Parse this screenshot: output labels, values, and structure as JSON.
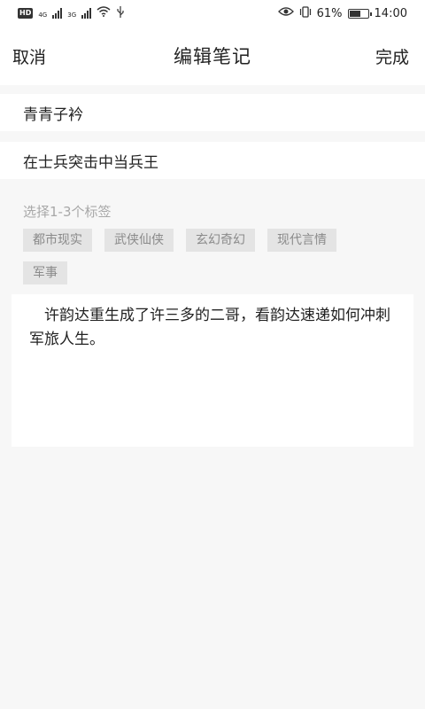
{
  "status_bar": {
    "hd": "HD",
    "net1": "4G",
    "net2": "3G",
    "battery_percent": "61%",
    "battery_level": 0.61,
    "time": "14:00",
    "icons": [
      "hd-icon",
      "signal-icon",
      "wifi-icon",
      "usb-icon",
      "eye-icon",
      "vibrate-icon",
      "battery-icon"
    ]
  },
  "header": {
    "cancel_label": "取消",
    "title": "编辑笔记",
    "done_label": "完成"
  },
  "form": {
    "title_value": "青青子衿",
    "book_value": "在士兵突击中当兵王"
  },
  "tags": {
    "label": "选择1-3个标签",
    "items": [
      "都市现实",
      "武侠仙侠",
      "玄幻奇幻",
      "现代言情",
      "军事"
    ]
  },
  "note": {
    "content": "许韵达重生成了许三多的二哥，看韵达速递如何冲刺军旅人生。"
  },
  "colors": {
    "background": "#f7f7f7",
    "card": "#ffffff",
    "tag_bg": "#e4e4e4",
    "tag_text": "#8a8a8a",
    "hint_text": "#a8a8a8"
  }
}
